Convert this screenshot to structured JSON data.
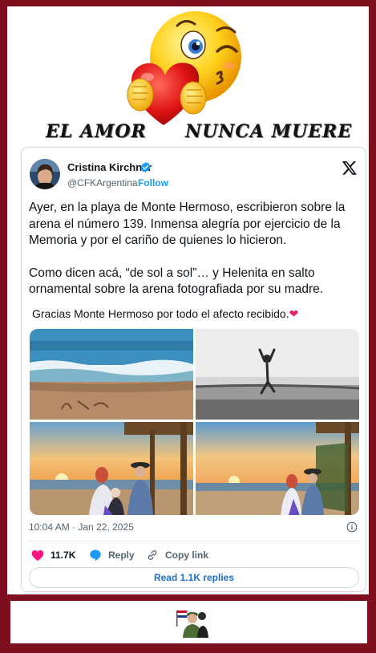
{
  "banner": {
    "headline_left": "EL AMOR",
    "headline_right": "NUNCA MUERE",
    "emoji_icon": "kissing-emoji-holding-heart-icon"
  },
  "tweet": {
    "author_name": "Cristina Kirchner",
    "handle": "@CFKArgentina",
    "separator": "·",
    "follow_label": "Follow",
    "verified_icon": "verified-badge-icon",
    "platform_icon": "x-logo-icon",
    "paragraph_1": "Ayer, en la playa de Monte Hermoso, escribieron sobre la arena el número 139. Inmensa alegría por ejercicio de la Memoria y por el cariño de quienes lo hicieron.",
    "paragraph_2": "Como dicen acá, “de sol a sol”… y Helenita en salto ornamental sobre la arena fotografiada por su madre.",
    "thanks_text": "Gracias Monte Hermoso por todo el afecto recibido.",
    "thanks_emoji": "❤",
    "timestamp": "10:04 AM · Jan 22, 2025",
    "likes_count": "11.7K",
    "reply_label": "Reply",
    "copy_link_label": "Copy link",
    "read_replies_label": "Read 1.1K replies"
  },
  "colors": {
    "frame": "#7e0f1e",
    "link_blue": "#1d9bf0",
    "like_pink": "#f91880"
  },
  "footer": {
    "icon": "soldier-with-flag-icon"
  }
}
